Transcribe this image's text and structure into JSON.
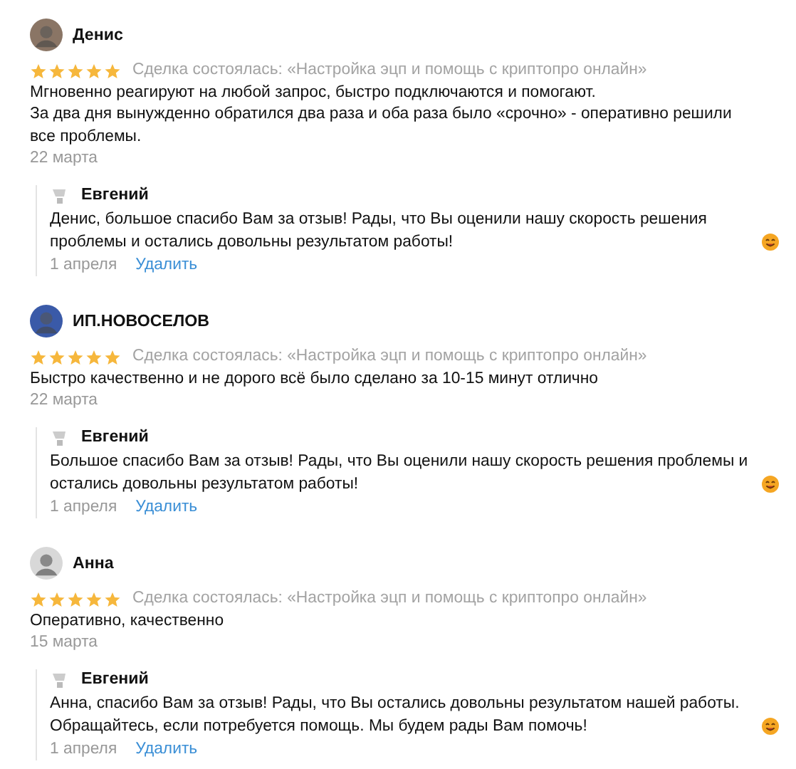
{
  "reviews": [
    {
      "author": "Денис",
      "stars": 5,
      "deal": "Сделка состоялась: «Настройка эцп и помощь с криптопро онлайн»",
      "text": [
        "Мгновенно реагируют на любой запрос, быстро подключаются и помогают.",
        "За два дня вынужденно обратился два раза и оба раза было «срочно» - оперативно решили все проблемы."
      ],
      "date": "22 марта",
      "reply": {
        "author": "Евгений",
        "text": "Денис, большое спасибо Вам за отзыв! Рады, что Вы оценили нашу скорость решения проблемы и остались довольны результатом работы!",
        "date": "1 апреля",
        "action": "Удалить"
      }
    },
    {
      "author": "ИП.НОВОСЕЛОВ",
      "stars": 5,
      "deal": "Сделка состоялась: «Настройка эцп и помощь с криптопро онлайн»",
      "text": [
        "Быстро качественно и не дорого всё было сделано за 10-15 минут отлично"
      ],
      "date": "22 марта",
      "reply": {
        "author": "Евгений",
        "text": "Большое спасибо Вам за отзыв! Рады, что Вы оценили нашу скорость решения проблемы и остались довольны результатом работы!",
        "date": "1 апреля",
        "action": "Удалить"
      }
    },
    {
      "author": "Анна",
      "stars": 5,
      "deal": "Сделка состоялась: «Настройка эцп и помощь с криптопро онлайн»",
      "text": [
        "Оперативно, качественно"
      ],
      "date": "15 марта",
      "reply": {
        "author": "Евгений",
        "text": "Анна, спасибо Вам за отзыв! Рады, что Вы остались довольны результатом нашей работы. Обращайтесь, если потребуется помощь. Мы будем рады Вам помочь!",
        "date": "1 апреля",
        "action": "Удалить"
      }
    }
  ]
}
